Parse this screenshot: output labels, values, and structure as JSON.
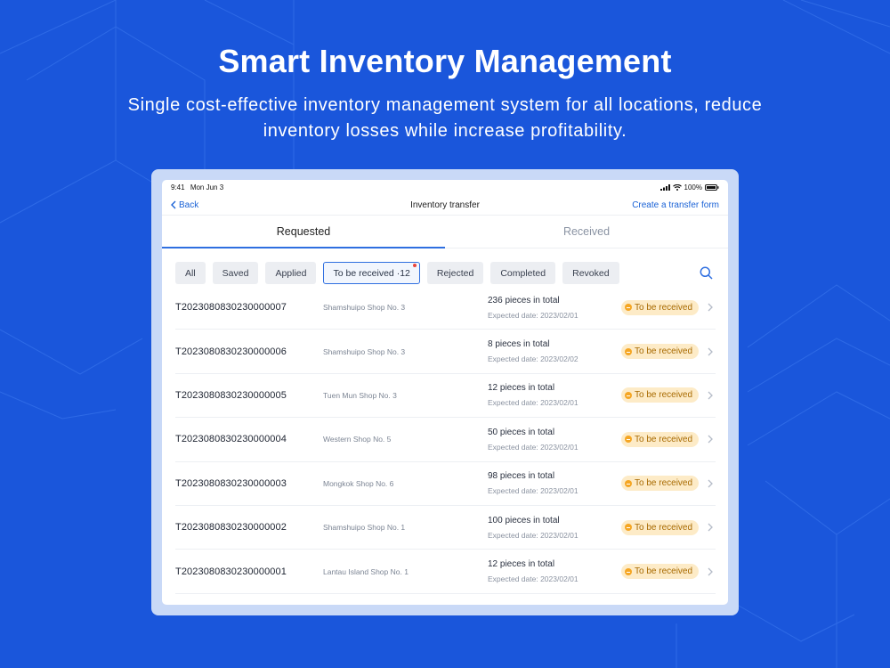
{
  "hero": {
    "title": "Smart Inventory Management",
    "subtitle": "Single cost-effective inventory management system for all locations, reduce inventory losses while increase profitability."
  },
  "status_bar": {
    "time": "9:41",
    "date": "Mon Jun 3",
    "battery": "100%"
  },
  "nav": {
    "back_label": "Back",
    "title": "Inventory transfer",
    "action_label": "Create a transfer form"
  },
  "tabs": [
    {
      "label": "Requested",
      "active": true
    },
    {
      "label": "Received",
      "active": false
    }
  ],
  "filters": [
    {
      "label": "All"
    },
    {
      "label": "Saved"
    },
    {
      "label": "Applied"
    },
    {
      "label": "To be received ·12",
      "selected": true,
      "dot": true
    },
    {
      "label": "Rejected"
    },
    {
      "label": "Completed"
    },
    {
      "label": "Revoked"
    }
  ],
  "transfers": [
    {
      "code": "T2023080830230000007",
      "shop": "Shamshuipo Shop No. 3",
      "pieces": "236 pieces in total",
      "date": "Expected date: 2023/02/01",
      "status": "To be received"
    },
    {
      "code": "T2023080830230000006",
      "shop": "Shamshuipo Shop No. 3",
      "pieces": "8 pieces in total",
      "date": "Expected date: 2023/02/02",
      "status": "To be received"
    },
    {
      "code": "T2023080830230000005",
      "shop": "Tuen Mun Shop No. 3",
      "pieces": "12 pieces in total",
      "date": "Expected date: 2023/02/01",
      "status": "To be received"
    },
    {
      "code": "T2023080830230000004",
      "shop": "Western Shop No. 5",
      "pieces": "50 pieces in total",
      "date": "Expected date: 2023/02/01",
      "status": "To be received"
    },
    {
      "code": "T2023080830230000003",
      "shop": "Mongkok Shop No. 6",
      "pieces": "98 pieces in total",
      "date": "Expected date: 2023/02/01",
      "status": "To be received"
    },
    {
      "code": "T2023080830230000002",
      "shop": "Shamshuipo Shop No. 1",
      "pieces": "100 pieces in total",
      "date": "Expected date: 2023/02/01",
      "status": "To be received"
    },
    {
      "code": "T2023080830230000001",
      "shop": "Lantau Island Shop No. 1",
      "pieces": "12 pieces in total",
      "date": "Expected date: 2023/02/01",
      "status": "To be received"
    }
  ],
  "colors": {
    "background": "#1a56db",
    "accent": "#2f6fe0",
    "badge_bg": "#fdebc7",
    "badge_text": "#a86a00"
  },
  "icons": [
    "chevron-left-icon",
    "signal-icon",
    "wifi-icon",
    "battery-icon",
    "search-icon",
    "status-pending-icon",
    "chevron-right-icon"
  ]
}
